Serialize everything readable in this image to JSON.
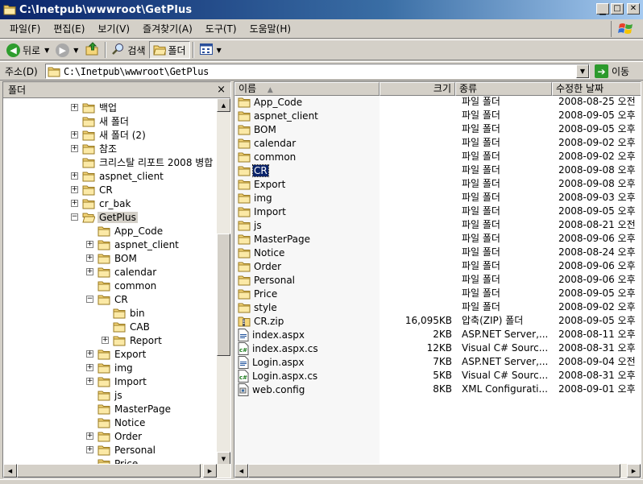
{
  "window": {
    "title": "C:\\Inetpub\\wwwroot\\GetPlus"
  },
  "menu": [
    "파일(F)",
    "편집(E)",
    "보기(V)",
    "즐겨찾기(A)",
    "도구(T)",
    "도움말(H)"
  ],
  "toolbar": {
    "back_label": "뒤로",
    "search_label": "검색",
    "folders_label": "폴더"
  },
  "address": {
    "label": "주소(D)",
    "value": "C:\\Inetpub\\wwwroot\\GetPlus",
    "go_label": "이동"
  },
  "tree": {
    "header": "폴더",
    "close": "×",
    "rows": [
      {
        "label": "백업",
        "indent": 0,
        "pm": "+"
      },
      {
        "label": "새 폴더",
        "indent": 0,
        "pm": ""
      },
      {
        "label": "새 폴더 (2)",
        "indent": 0,
        "pm": "+"
      },
      {
        "label": "참조",
        "indent": 0,
        "pm": "+"
      },
      {
        "label": "크리스탈 리포트 2008 병합",
        "indent": 0,
        "pm": ""
      },
      {
        "label": "aspnet_client",
        "indent": 0,
        "pm": "+"
      },
      {
        "label": "CR",
        "indent": 0,
        "pm": "+"
      },
      {
        "label": "cr_bak",
        "indent": 0,
        "pm": "+"
      },
      {
        "label": "GetPlus",
        "indent": 0,
        "pm": "-",
        "selected": true,
        "open": true
      },
      {
        "label": "App_Code",
        "indent": 1,
        "pm": ""
      },
      {
        "label": "aspnet_client",
        "indent": 1,
        "pm": "+"
      },
      {
        "label": "BOM",
        "indent": 1,
        "pm": "+"
      },
      {
        "label": "calendar",
        "indent": 1,
        "pm": "+"
      },
      {
        "label": "common",
        "indent": 1,
        "pm": ""
      },
      {
        "label": "CR",
        "indent": 1,
        "pm": "-"
      },
      {
        "label": "bin",
        "indent": 2,
        "pm": ""
      },
      {
        "label": "CAB",
        "indent": 2,
        "pm": ""
      },
      {
        "label": "Report",
        "indent": 2,
        "pm": "+"
      },
      {
        "label": "Export",
        "indent": 1,
        "pm": "+"
      },
      {
        "label": "img",
        "indent": 1,
        "pm": "+"
      },
      {
        "label": "Import",
        "indent": 1,
        "pm": "+"
      },
      {
        "label": "js",
        "indent": 1,
        "pm": ""
      },
      {
        "label": "MasterPage",
        "indent": 1,
        "pm": ""
      },
      {
        "label": "Notice",
        "indent": 1,
        "pm": ""
      },
      {
        "label": "Order",
        "indent": 1,
        "pm": "+"
      },
      {
        "label": "Personal",
        "indent": 1,
        "pm": "+"
      },
      {
        "label": "Price",
        "indent": 1,
        "pm": ""
      }
    ]
  },
  "list": {
    "columns": {
      "name": "이름",
      "size": "크기",
      "type": "종류",
      "date": "수정한 날짜"
    },
    "rows": [
      {
        "name": "App_Code",
        "size": "",
        "type": "파일 폴더",
        "date": "2008-08-25 오전",
        "icon": "folder"
      },
      {
        "name": "aspnet_client",
        "size": "",
        "type": "파일 폴더",
        "date": "2008-09-05 오후",
        "icon": "folder"
      },
      {
        "name": "BOM",
        "size": "",
        "type": "파일 폴더",
        "date": "2008-09-05 오후",
        "icon": "folder"
      },
      {
        "name": "calendar",
        "size": "",
        "type": "파일 폴더",
        "date": "2008-09-02 오후",
        "icon": "folder"
      },
      {
        "name": "common",
        "size": "",
        "type": "파일 폴더",
        "date": "2008-09-02 오후",
        "icon": "folder"
      },
      {
        "name": "CR",
        "size": "",
        "type": "파일 폴더",
        "date": "2008-09-08 오후",
        "icon": "folder",
        "selected": true
      },
      {
        "name": "Export",
        "size": "",
        "type": "파일 폴더",
        "date": "2008-09-08 오후",
        "icon": "folder"
      },
      {
        "name": "img",
        "size": "",
        "type": "파일 폴더",
        "date": "2008-09-03 오후",
        "icon": "folder"
      },
      {
        "name": "Import",
        "size": "",
        "type": "파일 폴더",
        "date": "2008-09-05 오후",
        "icon": "folder"
      },
      {
        "name": "js",
        "size": "",
        "type": "파일 폴더",
        "date": "2008-08-21 오전",
        "icon": "folder"
      },
      {
        "name": "MasterPage",
        "size": "",
        "type": "파일 폴더",
        "date": "2008-09-06 오후",
        "icon": "folder"
      },
      {
        "name": "Notice",
        "size": "",
        "type": "파일 폴더",
        "date": "2008-08-24 오후",
        "icon": "folder"
      },
      {
        "name": "Order",
        "size": "",
        "type": "파일 폴더",
        "date": "2008-09-06 오후",
        "icon": "folder"
      },
      {
        "name": "Personal",
        "size": "",
        "type": "파일 폴더",
        "date": "2008-09-06 오후",
        "icon": "folder"
      },
      {
        "name": "Price",
        "size": "",
        "type": "파일 폴더",
        "date": "2008-09-05 오후",
        "icon": "folder"
      },
      {
        "name": "style",
        "size": "",
        "type": "파일 폴더",
        "date": "2008-09-02 오후",
        "icon": "folder"
      },
      {
        "name": "CR.zip",
        "size": "16,095KB",
        "type": "압축(ZIP) 폴더",
        "date": "2008-09-05 오후",
        "icon": "zip"
      },
      {
        "name": "index.aspx",
        "size": "2KB",
        "type": "ASP.NET Server,...",
        "date": "2008-08-11 오후",
        "icon": "aspx"
      },
      {
        "name": "index.aspx.cs",
        "size": "12KB",
        "type": "Visual C# Sourc...",
        "date": "2008-08-31 오후",
        "icon": "cs"
      },
      {
        "name": "Login.aspx",
        "size": "7KB",
        "type": "ASP.NET Server,...",
        "date": "2008-09-04 오전",
        "icon": "aspx"
      },
      {
        "name": "Login.aspx.cs",
        "size": "5KB",
        "type": "Visual C# Sourc...",
        "date": "2008-08-31 오후",
        "icon": "cs"
      },
      {
        "name": "web.config",
        "size": "8KB",
        "type": "XML Configurati...",
        "date": "2008-09-01 오후",
        "icon": "config"
      }
    ]
  },
  "colors": {
    "title_bar": "#0a246a",
    "selection": "#0a246a",
    "folder": "#f5d67a",
    "chrome": "#d4d0c8"
  }
}
